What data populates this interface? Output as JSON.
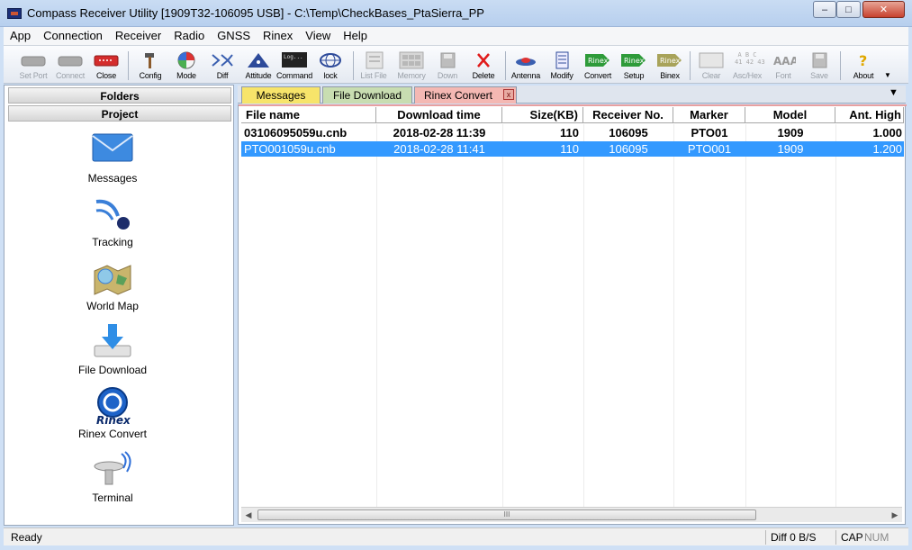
{
  "window": {
    "title": "Compass Receiver Utility [1909T32-106095 USB] - C:\\Temp\\CheckBases_PtaSierra_PP",
    "min_glyph": "–",
    "max_glyph": "□",
    "close_glyph": "✕"
  },
  "menu": [
    "App",
    "Connection",
    "Receiver",
    "Radio",
    "GNSS",
    "Rinex",
    "View",
    "Help"
  ],
  "toolbar": {
    "setport": "Set Port",
    "connect": "Connect",
    "close": "Close",
    "config": "Config",
    "mode": "Mode",
    "diff": "Diff",
    "attitude": "Attitude",
    "command": "Command",
    "lock": "lock",
    "listfile": "List File",
    "memory": "Memory",
    "down": "Down",
    "delete": "Delete",
    "antenna": "Antenna",
    "modify": "Modify",
    "convert": "Convert",
    "setup": "Setup",
    "binex": "Binex",
    "clear": "Clear",
    "aschex": "Asc/Hex",
    "font": "Font",
    "save": "Save",
    "about": "About",
    "rinex_badge": "Rinex",
    "ascii_sample": "A B C\n41 42 43",
    "command_sample": "Log..."
  },
  "left_panel": {
    "folders": "Folders",
    "project": "Project",
    "items": [
      {
        "label": "Messages",
        "icon": "envelope-icon"
      },
      {
        "label": "Tracking",
        "icon": "satellite-icon"
      },
      {
        "label": "World Map",
        "icon": "world-map-icon"
      },
      {
        "label": "File Download",
        "icon": "download-icon"
      },
      {
        "label": "Rinex Convert",
        "icon": "rinex-icon"
      },
      {
        "label": "Terminal",
        "icon": "antenna-terminal-icon"
      }
    ],
    "rinex_icon_text": "Rinex"
  },
  "tabs": {
    "messages": "Messages",
    "file_download": "File Download",
    "rinex_convert": "Rinex Convert",
    "close_glyph": "x",
    "dropdown_glyph": "▼"
  },
  "table": {
    "headers": {
      "file_name": "File name",
      "download_time": "Download time",
      "size": "Size(KB)",
      "receiver_no": "Receiver No.",
      "marker": "Marker",
      "model": "Model",
      "ant_high": "Ant. High"
    },
    "rows": [
      {
        "file_name": "03106095059u.cnb",
        "download_time": "2018-02-28 11:39",
        "size": "110",
        "receiver_no": "106095",
        "marker": "PTO01",
        "model": "1909",
        "ant_high": "1.000"
      },
      {
        "file_name": "PTO001059u.cnb",
        "download_time": "2018-02-28 11:41",
        "size": "110",
        "receiver_no": "106095",
        "marker": "PTO001",
        "model": "1909",
        "ant_high": "1.200"
      }
    ],
    "scroll_left": "◀",
    "scroll_right": "▶",
    "scroll_grip": "III"
  },
  "status": {
    "ready": "Ready",
    "diff": "Diff 0 B/S",
    "cap": "CAP",
    "num": "NUM"
  },
  "colors": {
    "selection": "#3399ff",
    "tab_messages": "#f7e46a",
    "tab_file_download": "#c8ddb1",
    "tab_rinex_convert": "#f4b8b3"
  }
}
